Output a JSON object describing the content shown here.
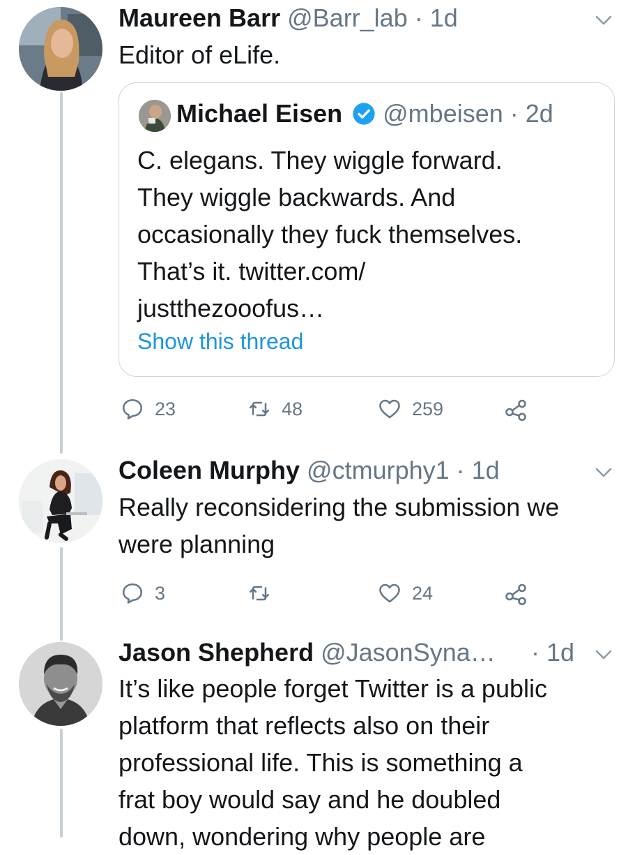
{
  "colors": {
    "text": "#14171a",
    "muted": "#657786",
    "link": "#1b95e0",
    "thread_line": "#c4cfd6",
    "border": "#ccd6dd",
    "verified": "#1da1f2"
  },
  "tweets": [
    {
      "name": "Maureen Barr",
      "handle": "@Barr_lab",
      "time": "· 1d",
      "text": "Editor of eLife.",
      "quoted": {
        "name": "Michael Eisen",
        "handle": "@mbeisen",
        "time": "· 2d",
        "lines": [
          "C. elegans. They wiggle forward.",
          "They wiggle backwards. And",
          "occasionally they fuck themselves.",
          "That’s it. twitter.com/",
          "justthezooofus…"
        ],
        "show_thread": "Show this thread"
      },
      "actions": {
        "replies": "23",
        "retweets": "48",
        "likes": "259"
      }
    },
    {
      "name": "Coleen Murphy",
      "handle": "@ctmurphy1",
      "time": "· 1d",
      "lines": [
        "Really reconsidering the submission we",
        "were planning"
      ],
      "actions": {
        "replies": "3",
        "retweets": "",
        "likes": "24"
      }
    },
    {
      "name": "Jason Shepherd",
      "handle": "@JasonSyna…",
      "time": "· 1d",
      "lines": [
        "It’s like people forget Twitter is a public",
        "platform that reflects also on their",
        "professional life. This is something a",
        "frat boy would say and he doubled",
        "down, wondering why people are"
      ]
    }
  ]
}
